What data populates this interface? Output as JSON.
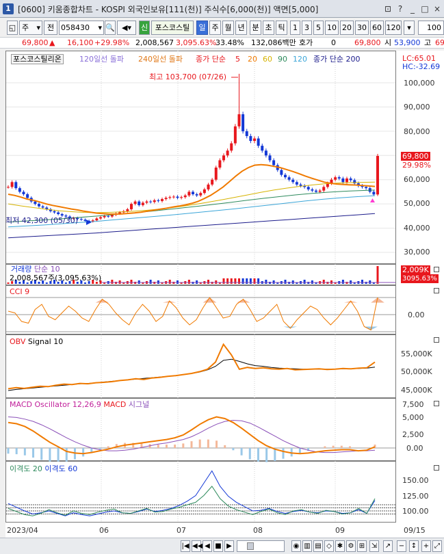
{
  "window": {
    "title": "[0600] 키움종합차트 - KOSPI 외국인보유[111(천)] 주식수[6,000(천)] 액면[5,000]",
    "app_icon": "1",
    "buttons": [
      "⊡",
      "?",
      "_",
      "□",
      "×"
    ]
  },
  "toolbar": {
    "market": "주",
    "type": "전",
    "code": "058430",
    "indicator_prefix": "신",
    "indicator": "포스코스틸",
    "periods": [
      "일",
      "주",
      "월",
      "년",
      "분",
      "초",
      "틱"
    ],
    "active_period": "일",
    "numbers": [
      "1",
      "3",
      "5",
      "10",
      "20",
      "30",
      "60",
      "120"
    ],
    "count": "100"
  },
  "ticker": {
    "price": "69,800",
    "change": "16,100",
    "change_pct": "+29.98%",
    "volume": "2,008,567",
    "volume_pct": "3,095.63%",
    "turnover": "33.48%",
    "amount": "132,086백만",
    "hoga_label": "호가",
    "hoga": "0",
    "hoga_price": "69,800",
    "open_label": "시",
    "open": "53,900",
    "high_label": "고",
    "high": "69"
  },
  "main_chart": {
    "stock_name": "포스코스틸리온",
    "legend": [
      {
        "text": "120일선 돌파",
        "color": "#8a6fd8"
      },
      {
        "text": "240일선 돌파",
        "color": "#e07818"
      },
      {
        "text": "종가 단순",
        "color": "#e8171d"
      },
      {
        "text": "5",
        "color": "#e8171d"
      },
      {
        "text": "20",
        "color": "#f07a00"
      },
      {
        "text": "60",
        "color": "#d6b300"
      },
      {
        "text": "90",
        "color": "#2d8a5c"
      },
      {
        "text": "120",
        "color": "#3aa5d8"
      },
      {
        "text": "종가 단순 200",
        "color": "#1a1a8a"
      }
    ],
    "lc": "LC:65.01",
    "hc": "HC:-32.69",
    "high_annotation": "최고 103,700 (07/26)",
    "low_annotation": "최저 42,300 (05/30)",
    "last_price": "69,800",
    "last_pct": "29.98%",
    "y_ticks": [
      "100,000",
      "90,000",
      "80,000",
      "70,000",
      "60,000",
      "50,000",
      "40,000",
      "30,000"
    ]
  },
  "volume_pane": {
    "legend": "거래량 단순 10",
    "legend_name": "거래량",
    "legend_ma": "단순 10",
    "info": "2,008,567주(3,095.63%)",
    "last": "2,009K",
    "last_pct": "3095.63%"
  },
  "cci_pane": {
    "legend": "CCI 9",
    "y_ticks": [
      "0.00"
    ]
  },
  "obv_pane": {
    "legend_a": "OBV",
    "legend_b": "Signal 10",
    "y_ticks": [
      "55,000K",
      "50,000K",
      "45,000K"
    ]
  },
  "macd_pane": {
    "legend_a": "MACD Oscillator 12,26,9",
    "legend_b": "MACD",
    "legend_c": "시그널",
    "y_ticks": [
      "7,500",
      "5,000",
      "2,500",
      "0.00"
    ]
  },
  "disparity_pane": {
    "legend_a": "이격도 20",
    "legend_b": "이격도 60",
    "y_ticks": [
      "150.00",
      "125.00",
      "100.00"
    ]
  },
  "x_axis": [
    "2023/04",
    "06",
    "07",
    "08",
    "09",
    "09/15"
  ],
  "chart_data": [
    {
      "type": "candlestick",
      "title": "포스코스틸리온",
      "y_range": [
        30000,
        105000
      ],
      "high": {
        "value": 103700,
        "date": "07/26"
      },
      "low": {
        "value": 42300,
        "date": "05/30"
      },
      "last": 69800,
      "close": [
        57000,
        59000,
        56500,
        55000,
        54000,
        52500,
        51000,
        50000,
        49000,
        48500,
        47800,
        47000,
        46500,
        45800,
        45200,
        44800,
        44000,
        44200,
        43800,
        43500,
        43000,
        42800,
        43200,
        44000,
        44500,
        45000,
        44800,
        45500,
        46000,
        46500,
        47000,
        47800,
        50000,
        51000,
        49500,
        50500,
        51000,
        50800,
        51500,
        51200,
        52000,
        52500,
        52800,
        53000,
        52500,
        52800,
        53500,
        55000,
        54000,
        53500,
        54500,
        56000,
        58000,
        60000,
        65000,
        68000,
        70000,
        72000,
        75000,
        82000,
        87000,
        80000,
        78000,
        76000,
        77000,
        74000,
        72000,
        70000,
        68000,
        66000,
        64000,
        62000,
        61000,
        60000,
        59000,
        58000,
        57500,
        57000,
        56000,
        55500,
        55000,
        55500,
        57000,
        58500,
        60000,
        61000,
        60500,
        59000,
        60500,
        59800,
        58500,
        57500,
        57000,
        56500,
        55000,
        53900,
        69800
      ],
      "ma20": [
        54000,
        53500,
        52800,
        52000,
        51500,
        50800,
        50000,
        49400,
        48900,
        48400,
        47900,
        47500,
        47000,
        46600,
        46200,
        46000,
        45800,
        45800,
        45900,
        46100,
        46300,
        46600,
        47000,
        47400,
        47800,
        48200,
        48700,
        49100,
        49600,
        50200,
        51000,
        52200,
        53500,
        55200,
        57000,
        59200,
        61500,
        63500,
        65000,
        66000,
        66200,
        66000,
        65500,
        65000,
        64200,
        63400,
        62500,
        61500,
        60600,
        59800,
        59000,
        58500,
        58200,
        58000,
        57900,
        57800,
        57600,
        57400,
        57200
      ],
      "ma60": [
        50000,
        49200,
        48500,
        47800,
        47200,
        46800,
        46500,
        46400,
        46500,
        46700,
        47000,
        47400,
        47900,
        48500,
        49200,
        50000,
        50900,
        51800,
        52800,
        53800,
        54800,
        55700,
        56500,
        57200,
        57800,
        58300,
        58600,
        58800,
        58900,
        59000
      ],
      "ma90": [
        42500,
        42900,
        43300,
        43700,
        44200,
        44700,
        45200,
        45800,
        46400,
        47000,
        47700,
        48400,
        49100,
        49900,
        50700,
        51500,
        52300,
        53000,
        53700,
        54300,
        54800,
        55200,
        55500,
        55700
      ],
      "ma120": [
        40500,
        40900,
        41300,
        41800,
        42300,
        42800,
        43400,
        44000,
        44600,
        45200,
        45900,
        46600,
        47300,
        48000,
        48800,
        49600,
        50400,
        51200,
        51900,
        52500,
        53000,
        53400
      ],
      "ma200": [
        36000,
        36400,
        36800,
        37200,
        37600,
        38000,
        38500,
        39000,
        39500,
        40000,
        40500,
        41000,
        41500,
        42000,
        42500,
        43000,
        43500,
        44000,
        44500,
        45000,
        45500,
        46000
      ]
    },
    {
      "type": "bar",
      "title": "거래량",
      "last": 2009,
      "unit": "K"
    },
    {
      "type": "line",
      "title": "CCI 9",
      "values": [
        20,
        10,
        -40,
        -50,
        30,
        60,
        -10,
        -30,
        10,
        50,
        20,
        -20,
        -40,
        30,
        90,
        60,
        10,
        -30,
        -60,
        10,
        60,
        20,
        -40,
        -10,
        80,
        40,
        -20,
        -60,
        -30,
        40,
        100,
        40,
        -20,
        -10,
        60,
        90,
        30,
        -40,
        -20,
        20,
        60,
        -40,
        -80,
        -30,
        10,
        50,
        30,
        -20,
        -60,
        -20,
        30,
        80,
        20,
        -70,
        -90,
        100
      ]
    },
    {
      "type": "line",
      "title": "OBV",
      "series": [
        {
          "name": "OBV",
          "values": [
            45500,
            45800,
            45600,
            45900,
            46200,
            46100,
            46500,
            46800,
            46700,
            47000,
            46900,
            47200,
            47300,
            47500,
            47800,
            48000,
            48300,
            48100,
            48500,
            48700,
            49000,
            49200,
            49500,
            49800,
            50300,
            51000,
            53000,
            58000,
            55000,
            51000,
            51500,
            51200,
            51400,
            51100,
            51000,
            51200,
            50800,
            50900,
            51000,
            51100,
            50900,
            51000,
            51200,
            51100,
            51300,
            51400,
            53000
          ]
        },
        {
          "name": "Signal 10",
          "values": [
            45000,
            45300,
            45500,
            45700,
            45900,
            46100,
            46300,
            46500,
            46700,
            46900,
            47000,
            47200,
            47400,
            47600,
            47800,
            48000,
            48200,
            48400,
            48600,
            48800,
            49000,
            49200,
            49500,
            49800,
            50200,
            50800,
            51800,
            53500,
            53800,
            53200,
            52500,
            52000,
            51800,
            51500,
            51300,
            51200,
            51100,
            51000,
            51000,
            51000,
            51000,
            51000,
            51100,
            51100,
            51200,
            51300,
            51600
          ]
        }
      ]
    },
    {
      "type": "line",
      "title": "MACD Oscillator 12,26,9",
      "series": [
        {
          "name": "MACD",
          "values": [
            4500,
            4300,
            3800,
            3000,
            2000,
            1000,
            200,
            -600,
            -900,
            -1000,
            -800,
            -500,
            -200,
            200,
            500,
            700,
            900,
            1100,
            1300,
            1500,
            1800,
            2300,
            3200,
            4200,
            5000,
            5500,
            5200,
            4500,
            3500,
            2400,
            1300,
            400,
            -200,
            -600,
            -900,
            -1000,
            -900,
            -700,
            -500,
            -400,
            -300,
            -300,
            -500,
            -400,
            200
          ]
        },
        {
          "name": "시그널",
          "values": [
            5500,
            5400,
            5100,
            4700,
            4100,
            3400,
            2600,
            1800,
            1100,
            500,
            0,
            -300,
            -500,
            -500,
            -400,
            -200,
            100,
            400,
            700,
            900,
            1200,
            1500,
            2000,
            2700,
            3500,
            4200,
            4700,
            4900,
            4800,
            4400,
            3700,
            2900,
            2100,
            1300,
            600,
            0,
            -400,
            -700,
            -800,
            -800,
            -700,
            -600,
            -500,
            -500,
            -400
          ]
        }
      ]
    },
    {
      "type": "line",
      "title": "이격도",
      "series": [
        {
          "name": "이격도 20",
          "values": [
            104,
            99,
            94,
            92,
            96,
            102,
            97,
            93,
            100,
            96,
            94,
            98,
            101,
            103,
            97,
            96,
            100,
            104,
            98,
            99,
            103,
            106,
            110,
            114,
            125,
            140,
            120,
            108,
            102,
            98,
            94,
            99,
            103,
            97,
            94,
            100,
            102,
            98,
            96,
            101,
            99,
            95,
            97,
            104,
            96,
            120
          ]
        },
        {
          "name": "이격도 60",
          "values": [
            112,
            106,
            100,
            95,
            97,
            100,
            96,
            92,
            97,
            94,
            92,
            95,
            98,
            100,
            97,
            96,
            99,
            103,
            99,
            101,
            104,
            109,
            116,
            125,
            145,
            165,
            140,
            124,
            114,
            107,
            100,
            101,
            104,
            99,
            96,
            99,
            101,
            98,
            97,
            100,
            99,
            96,
            97,
            102,
            96,
            117
          ]
        }
      ]
    }
  ]
}
